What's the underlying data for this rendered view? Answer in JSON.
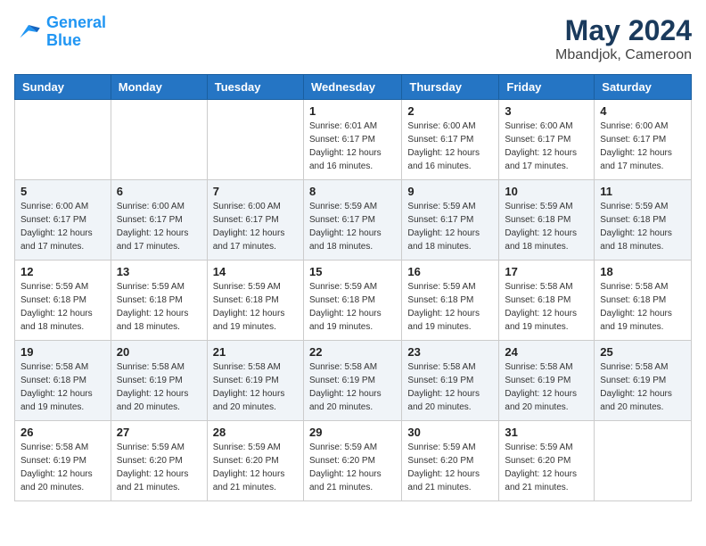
{
  "header": {
    "logo_general": "General",
    "logo_blue": "Blue",
    "month": "May 2024",
    "location": "Mbandjok, Cameroon"
  },
  "weekdays": [
    "Sunday",
    "Monday",
    "Tuesday",
    "Wednesday",
    "Thursday",
    "Friday",
    "Saturday"
  ],
  "weeks": [
    [
      {
        "day": "",
        "sunrise": "",
        "sunset": "",
        "daylight": ""
      },
      {
        "day": "",
        "sunrise": "",
        "sunset": "",
        "daylight": ""
      },
      {
        "day": "",
        "sunrise": "",
        "sunset": "",
        "daylight": ""
      },
      {
        "day": "1",
        "sunrise": "Sunrise: 6:01 AM",
        "sunset": "Sunset: 6:17 PM",
        "daylight": "Daylight: 12 hours and 16 minutes."
      },
      {
        "day": "2",
        "sunrise": "Sunrise: 6:00 AM",
        "sunset": "Sunset: 6:17 PM",
        "daylight": "Daylight: 12 hours and 16 minutes."
      },
      {
        "day": "3",
        "sunrise": "Sunrise: 6:00 AM",
        "sunset": "Sunset: 6:17 PM",
        "daylight": "Daylight: 12 hours and 17 minutes."
      },
      {
        "day": "4",
        "sunrise": "Sunrise: 6:00 AM",
        "sunset": "Sunset: 6:17 PM",
        "daylight": "Daylight: 12 hours and 17 minutes."
      }
    ],
    [
      {
        "day": "5",
        "sunrise": "Sunrise: 6:00 AM",
        "sunset": "Sunset: 6:17 PM",
        "daylight": "Daylight: 12 hours and 17 minutes."
      },
      {
        "day": "6",
        "sunrise": "Sunrise: 6:00 AM",
        "sunset": "Sunset: 6:17 PM",
        "daylight": "Daylight: 12 hours and 17 minutes."
      },
      {
        "day": "7",
        "sunrise": "Sunrise: 6:00 AM",
        "sunset": "Sunset: 6:17 PM",
        "daylight": "Daylight: 12 hours and 17 minutes."
      },
      {
        "day": "8",
        "sunrise": "Sunrise: 5:59 AM",
        "sunset": "Sunset: 6:17 PM",
        "daylight": "Daylight: 12 hours and 18 minutes."
      },
      {
        "day": "9",
        "sunrise": "Sunrise: 5:59 AM",
        "sunset": "Sunset: 6:17 PM",
        "daylight": "Daylight: 12 hours and 18 minutes."
      },
      {
        "day": "10",
        "sunrise": "Sunrise: 5:59 AM",
        "sunset": "Sunset: 6:18 PM",
        "daylight": "Daylight: 12 hours and 18 minutes."
      },
      {
        "day": "11",
        "sunrise": "Sunrise: 5:59 AM",
        "sunset": "Sunset: 6:18 PM",
        "daylight": "Daylight: 12 hours and 18 minutes."
      }
    ],
    [
      {
        "day": "12",
        "sunrise": "Sunrise: 5:59 AM",
        "sunset": "Sunset: 6:18 PM",
        "daylight": "Daylight: 12 hours and 18 minutes."
      },
      {
        "day": "13",
        "sunrise": "Sunrise: 5:59 AM",
        "sunset": "Sunset: 6:18 PM",
        "daylight": "Daylight: 12 hours and 18 minutes."
      },
      {
        "day": "14",
        "sunrise": "Sunrise: 5:59 AM",
        "sunset": "Sunset: 6:18 PM",
        "daylight": "Daylight: 12 hours and 19 minutes."
      },
      {
        "day": "15",
        "sunrise": "Sunrise: 5:59 AM",
        "sunset": "Sunset: 6:18 PM",
        "daylight": "Daylight: 12 hours and 19 minutes."
      },
      {
        "day": "16",
        "sunrise": "Sunrise: 5:59 AM",
        "sunset": "Sunset: 6:18 PM",
        "daylight": "Daylight: 12 hours and 19 minutes."
      },
      {
        "day": "17",
        "sunrise": "Sunrise: 5:58 AM",
        "sunset": "Sunset: 6:18 PM",
        "daylight": "Daylight: 12 hours and 19 minutes."
      },
      {
        "day": "18",
        "sunrise": "Sunrise: 5:58 AM",
        "sunset": "Sunset: 6:18 PM",
        "daylight": "Daylight: 12 hours and 19 minutes."
      }
    ],
    [
      {
        "day": "19",
        "sunrise": "Sunrise: 5:58 AM",
        "sunset": "Sunset: 6:18 PM",
        "daylight": "Daylight: 12 hours and 19 minutes."
      },
      {
        "day": "20",
        "sunrise": "Sunrise: 5:58 AM",
        "sunset": "Sunset: 6:19 PM",
        "daylight": "Daylight: 12 hours and 20 minutes."
      },
      {
        "day": "21",
        "sunrise": "Sunrise: 5:58 AM",
        "sunset": "Sunset: 6:19 PM",
        "daylight": "Daylight: 12 hours and 20 minutes."
      },
      {
        "day": "22",
        "sunrise": "Sunrise: 5:58 AM",
        "sunset": "Sunset: 6:19 PM",
        "daylight": "Daylight: 12 hours and 20 minutes."
      },
      {
        "day": "23",
        "sunrise": "Sunrise: 5:58 AM",
        "sunset": "Sunset: 6:19 PM",
        "daylight": "Daylight: 12 hours and 20 minutes."
      },
      {
        "day": "24",
        "sunrise": "Sunrise: 5:58 AM",
        "sunset": "Sunset: 6:19 PM",
        "daylight": "Daylight: 12 hours and 20 minutes."
      },
      {
        "day": "25",
        "sunrise": "Sunrise: 5:58 AM",
        "sunset": "Sunset: 6:19 PM",
        "daylight": "Daylight: 12 hours and 20 minutes."
      }
    ],
    [
      {
        "day": "26",
        "sunrise": "Sunrise: 5:58 AM",
        "sunset": "Sunset: 6:19 PM",
        "daylight": "Daylight: 12 hours and 20 minutes."
      },
      {
        "day": "27",
        "sunrise": "Sunrise: 5:59 AM",
        "sunset": "Sunset: 6:20 PM",
        "daylight": "Daylight: 12 hours and 21 minutes."
      },
      {
        "day": "28",
        "sunrise": "Sunrise: 5:59 AM",
        "sunset": "Sunset: 6:20 PM",
        "daylight": "Daylight: 12 hours and 21 minutes."
      },
      {
        "day": "29",
        "sunrise": "Sunrise: 5:59 AM",
        "sunset": "Sunset: 6:20 PM",
        "daylight": "Daylight: 12 hours and 21 minutes."
      },
      {
        "day": "30",
        "sunrise": "Sunrise: 5:59 AM",
        "sunset": "Sunset: 6:20 PM",
        "daylight": "Daylight: 12 hours and 21 minutes."
      },
      {
        "day": "31",
        "sunrise": "Sunrise: 5:59 AM",
        "sunset": "Sunset: 6:20 PM",
        "daylight": "Daylight: 12 hours and 21 minutes."
      },
      {
        "day": "",
        "sunrise": "",
        "sunset": "",
        "daylight": ""
      }
    ]
  ]
}
